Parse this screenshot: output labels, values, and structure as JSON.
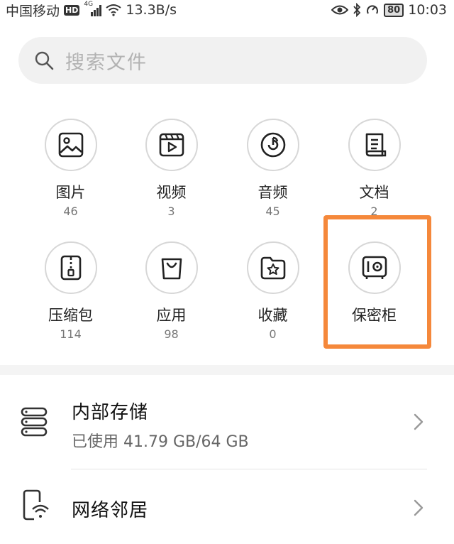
{
  "status_bar": {
    "carrier": "中国移动",
    "hd": "HD",
    "network": "4G",
    "speed": "13.3B/s",
    "battery": "80",
    "time": "10:03"
  },
  "search": {
    "placeholder": "搜索文件"
  },
  "categories": [
    {
      "label": "图片",
      "count": "46",
      "icon": "image-icon"
    },
    {
      "label": "视频",
      "count": "3",
      "icon": "video-icon"
    },
    {
      "label": "音频",
      "count": "45",
      "icon": "audio-icon"
    },
    {
      "label": "文档",
      "count": "2",
      "icon": "document-icon"
    },
    {
      "label": "压缩包",
      "count": "114",
      "icon": "zip-icon"
    },
    {
      "label": "应用",
      "count": "98",
      "icon": "app-bag-icon"
    },
    {
      "label": "收藏",
      "count": "0",
      "icon": "favorite-folder-icon"
    },
    {
      "label": "保密柜",
      "count": "",
      "icon": "safe-icon"
    }
  ],
  "highlight_color": "#f5883b",
  "storage": {
    "internal": {
      "title": "内部存储",
      "subtitle": "已使用 41.79 GB/64 GB",
      "icon": "storage-icon"
    },
    "network": {
      "title": "网络邻居",
      "icon": "network-neighbor-icon"
    }
  }
}
